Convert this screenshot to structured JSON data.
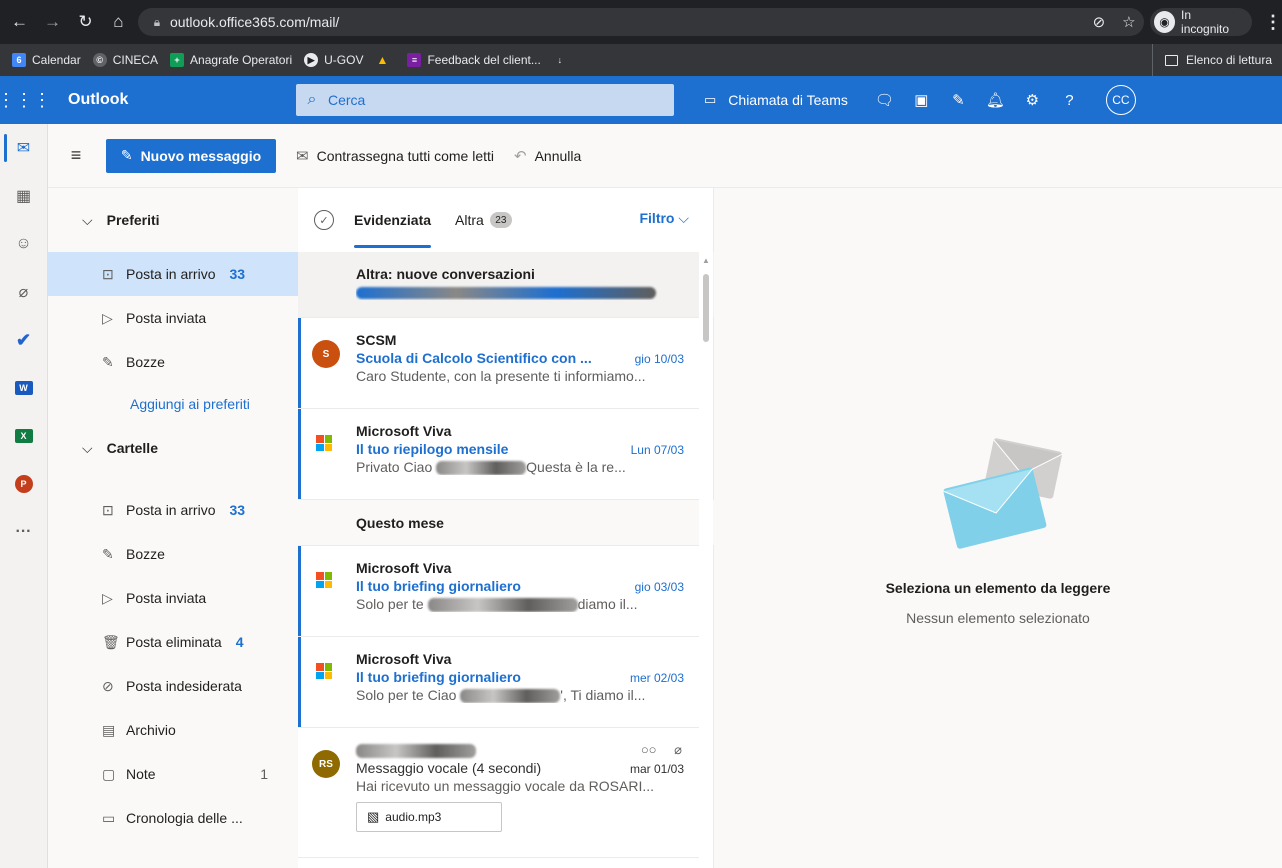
{
  "browser": {
    "url": "outlook.office365.com/mail/",
    "profile_label": "In incognito",
    "bookmarks": [
      {
        "label": "Calendar",
        "color": "#4285f4",
        "icon_text": "6"
      },
      {
        "label": "CINECA",
        "color": "#5f6368",
        "icon_text": "©"
      },
      {
        "label": "Anagrafe Operatori",
        "color": "#0f9d58",
        "icon_text": "+"
      },
      {
        "label": "U-GOV",
        "color": "#e8eaed",
        "icon_text": "▶"
      },
      {
        "label": "",
        "color": "#fbbc04",
        "icon_text": "▲"
      },
      {
        "label": "Feedback del client...",
        "color": "#7b1fa2",
        "icon_text": "≡"
      },
      {
        "label": "",
        "color": "#5f6368",
        "icon_text": "↓"
      }
    ],
    "reading_list_label": "Elenco di lettura"
  },
  "header": {
    "app_name": "Outlook",
    "search_placeholder": "Cerca",
    "teams_call_label": "Chiamata di Teams",
    "avatar_initials": "CC",
    "accent": "#1d6fd0"
  },
  "commands": {
    "new_message": "Nuovo messaggio",
    "mark_all_read": "Contrassegna tutti come letti",
    "undo": "Annulla"
  },
  "folders": {
    "favorites_label": "Preferiti",
    "favorites": [
      {
        "label": "Posta in arrivo",
        "count": "33",
        "icon": "inbox-icon"
      },
      {
        "label": "Posta inviata",
        "count": "",
        "icon": "sent-icon"
      },
      {
        "label": "Bozze",
        "count": "",
        "icon": "draft-icon"
      }
    ],
    "add_favorite": "Aggiungi ai preferiti",
    "folders_label": "Cartelle",
    "items": [
      {
        "label": "Posta in arrivo",
        "count": "33"
      },
      {
        "label": "Bozze",
        "count": ""
      },
      {
        "label": "Posta inviata",
        "count": ""
      },
      {
        "label": "Posta eliminata",
        "count": "4"
      },
      {
        "label": "Posta indesiderata",
        "count": ""
      },
      {
        "label": "Archivio",
        "count": ""
      },
      {
        "label": "Note",
        "count": "1"
      },
      {
        "label": "Cronologia delle ...",
        "count": ""
      }
    ]
  },
  "list": {
    "tab_focused": "Evidenziata",
    "tab_other": "Altra",
    "other_count": "23",
    "filter_label": "Filtro",
    "other_banner_title": "Altra: nuove conversazioni",
    "other_banner_sub": "C... in Teams: P...",
    "section_this_month": "Questo mese",
    "messages": [
      {
        "from": "SCSM",
        "subject": "Scuola di Calcolo Scientifico con ...",
        "date": "gio 10/03",
        "preview": "Caro Studente, con la presente ti informiamo...",
        "avatar": "S",
        "avatar_color": "#ca5010"
      },
      {
        "from": "Microsoft Viva",
        "subject": "Il tuo riepilogo mensile",
        "date": "Lun 07/03",
        "preview_a": "Privato Ciao ",
        "preview_b": "Questa è la re...",
        "avatar": ""
      },
      {
        "from": "Microsoft Viva",
        "subject": "Il tuo briefing giornaliero",
        "date": "gio 03/03",
        "preview_a": "Solo per te ",
        "preview_b": "diamo il...",
        "avatar": ""
      },
      {
        "from": "Microsoft Viva",
        "subject": "Il tuo briefing giornaliero",
        "date": "mer 02/03",
        "preview_a": "Solo per te Ciao ",
        "preview_b": "', Ti diamo il...",
        "avatar": ""
      },
      {
        "from": "",
        "subject": "Messaggio vocale (4 secondi)",
        "date": "mar 01/03",
        "preview": "Hai ricevuto un messaggio vocale da ROSARI...",
        "avatar": "RS",
        "avatar_color": "#8f6a00",
        "attachment": "audio.mp3"
      }
    ]
  },
  "reading": {
    "empty_title": "Seleziona un elemento da leggere",
    "empty_sub": "Nessun elemento selezionato"
  }
}
